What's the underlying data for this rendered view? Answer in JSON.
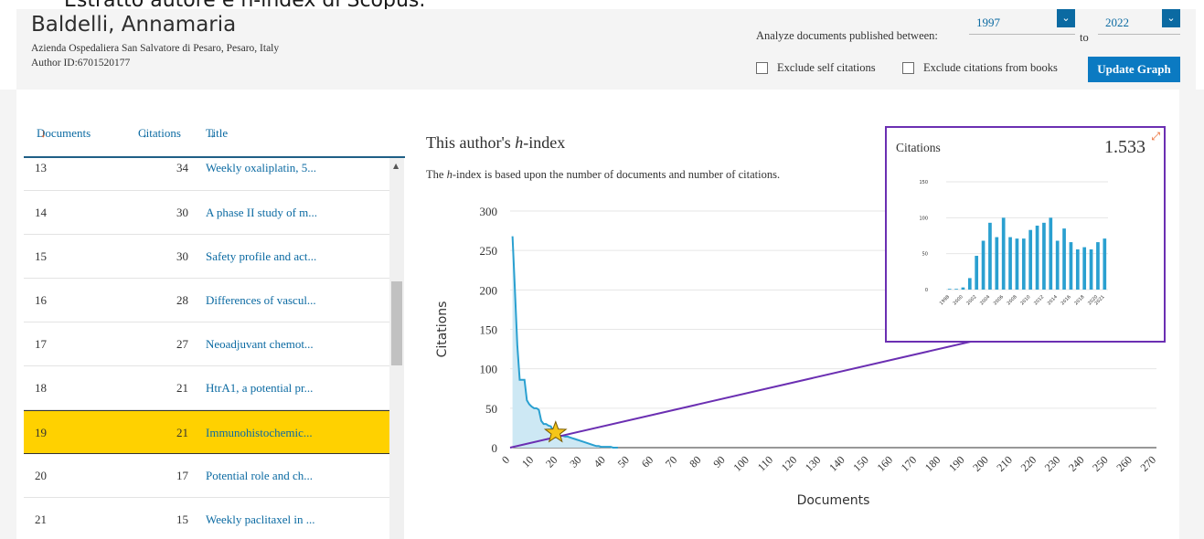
{
  "caption": "Estratto autore e h-index di Scopus.",
  "author": {
    "name": "Baldelli, Annamaria",
    "affiliation": "Azienda Ospedaliera San Salvatore di Pesaro, Pesaro, Italy",
    "author_id": "Author ID:6701520177"
  },
  "controls": {
    "range_label": "Analyze documents published between:",
    "year_from": "1997",
    "to_label": "to",
    "year_to": "2022",
    "exclude_self": "Exclude self citations",
    "exclude_books": "Exclude citations from books",
    "update_button": "Update Graph",
    "dropdown_icon": "chevron-down-icon"
  },
  "list": {
    "headers": {
      "documents": "Documents",
      "citations": "Citations",
      "title": "Title",
      "sort_icon": "sort-arrow-icon"
    },
    "rows": [
      {
        "num": "13",
        "citations": "34",
        "title": "Weekly oxaliplatin, 5..."
      },
      {
        "num": "14",
        "citations": "30",
        "title": "A phase II study of m..."
      },
      {
        "num": "15",
        "citations": "30",
        "title": "Safety profile and act..."
      },
      {
        "num": "16",
        "citations": "28",
        "title": "Differences of vascul..."
      },
      {
        "num": "17",
        "citations": "27",
        "title": "Neoadjuvant chemot..."
      },
      {
        "num": "18",
        "citations": "21",
        "title": "HtrA1, a potential pr..."
      },
      {
        "num": "19",
        "citations": "21",
        "title": "Immunohistochemic...",
        "selected": true
      },
      {
        "num": "20",
        "citations": "17",
        "title": "Potential role and ch..."
      },
      {
        "num": "21",
        "citations": "15",
        "title": "Weekly paclitaxel in ..."
      }
    ]
  },
  "hindex": {
    "title_prefix": "This author's ",
    "title_h": "h",
    "title_suffix": "-index",
    "subtitle_prefix": "The ",
    "subtitle_h": "h",
    "subtitle_suffix": "-index is based upon the number of documents and number of citations."
  },
  "inset": {
    "title": "Citations",
    "total": "1.533",
    "expand_icon": "expand-icon"
  },
  "chart_data": [
    {
      "type": "area",
      "title": "",
      "xlabel": "Documents",
      "ylabel": "Citations",
      "xlim": [
        0,
        270
      ],
      "ylim": [
        0,
        300
      ],
      "x_ticks": [
        0,
        10,
        20,
        30,
        40,
        50,
        60,
        70,
        80,
        90,
        100,
        110,
        120,
        130,
        140,
        150,
        160,
        170,
        180,
        190,
        200,
        210,
        220,
        230,
        240,
        250,
        260,
        270
      ],
      "y_ticks": [
        0,
        50,
        100,
        150,
        200,
        250,
        300
      ],
      "grid": true,
      "colors": {
        "line": "#2aa0d0",
        "fill": "#cde8f4",
        "hline": "#6b2fb2",
        "star": "#f5c518"
      },
      "x": [
        1,
        2,
        3,
        4,
        5,
        6,
        7,
        8,
        9,
        10,
        11,
        12,
        13,
        14,
        15,
        16,
        17,
        18,
        19,
        20,
        21,
        22,
        23,
        24,
        25,
        26,
        27,
        28,
        29,
        30,
        31,
        32,
        33,
        34,
        35,
        36,
        37,
        38,
        39,
        40,
        41,
        42,
        43,
        44,
        45
      ],
      "y": [
        268,
        200,
        130,
        86,
        86,
        86,
        60,
        55,
        52,
        50,
        50,
        48,
        34,
        30,
        30,
        28,
        27,
        21,
        21,
        17,
        15,
        15,
        14,
        14,
        13,
        12,
        11,
        10,
        9,
        8,
        7,
        6,
        5,
        4,
        3,
        2,
        2,
        1,
        1,
        1,
        1,
        1,
        0,
        0,
        0
      ],
      "h_index": 19,
      "h_line_end": [
        272,
        190
      ]
    },
    {
      "type": "bar",
      "title": "Citations",
      "categories": [
        "1998",
        "1999",
        "2000",
        "2001",
        "2002",
        "2003",
        "2004",
        "2005",
        "2006",
        "2007",
        "2008",
        "2009",
        "2010",
        "2011",
        "2012",
        "2013",
        "2014",
        "2015",
        "2016",
        "2017",
        "2018",
        "2019",
        "2020",
        "2021"
      ],
      "x_tick_labels": [
        "1998",
        "2000",
        "2002",
        "2004",
        "2006",
        "2008",
        "2010",
        "2012",
        "2014",
        "2016",
        "2018",
        "2020",
        "2021"
      ],
      "values": [
        1,
        1,
        3,
        16,
        47,
        68,
        93,
        73,
        100,
        73,
        71,
        71,
        83,
        89,
        93,
        100,
        68,
        85,
        66,
        56,
        59,
        56,
        66,
        71
      ],
      "ylim": [
        0,
        150
      ],
      "y_ticks": [
        0,
        50,
        100,
        150
      ],
      "color": "#2aa0d0"
    }
  ]
}
